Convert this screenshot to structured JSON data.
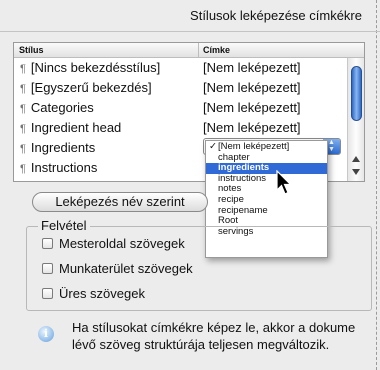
{
  "panel": {
    "title": "Stílusok leképezése címkékre"
  },
  "table": {
    "headers": [
      "Stílus",
      "Címke"
    ],
    "rows": [
      {
        "style": "[Nincs bekezdésstílus]",
        "tag": "[Nem leképezett]"
      },
      {
        "style": "[Egyszerű bekezdés]",
        "tag": "[Nem leképezett]"
      },
      {
        "style": "Categories",
        "tag": "[Nem leképezett]"
      },
      {
        "style": "Ingredient head",
        "tag": "[Nem leképezett]"
      },
      {
        "style": "Ingredients",
        "tag": ""
      },
      {
        "style": "Instructions",
        "tag": ""
      }
    ],
    "pilcrow": "¶"
  },
  "dropdown": {
    "check": "✓",
    "items": [
      "[Nem leképezett]",
      "chapter",
      "ingredients",
      "instructions",
      "notes",
      "recipe",
      "recipename",
      "Root",
      "servings"
    ],
    "selected": "ingredients"
  },
  "map_button": {
    "label": "Leképezés név szerint"
  },
  "include": {
    "legend": "Felvétel",
    "options": [
      {
        "label": "Mesteroldal szövegek",
        "checked": false
      },
      {
        "label": "Munkaterület szövegek",
        "checked": false
      },
      {
        "label": "Üres szövegek",
        "checked": false
      }
    ]
  },
  "info": {
    "icon": "info-icon",
    "line1": "Ha stílusokat címkékre képez le, akkor a dokume",
    "line2": "lévő szöveg struktúrája teljesen megváltozik."
  },
  "colors": {
    "accent": "#2f6ad7",
    "scroll_thumb": "#2c69c7"
  }
}
